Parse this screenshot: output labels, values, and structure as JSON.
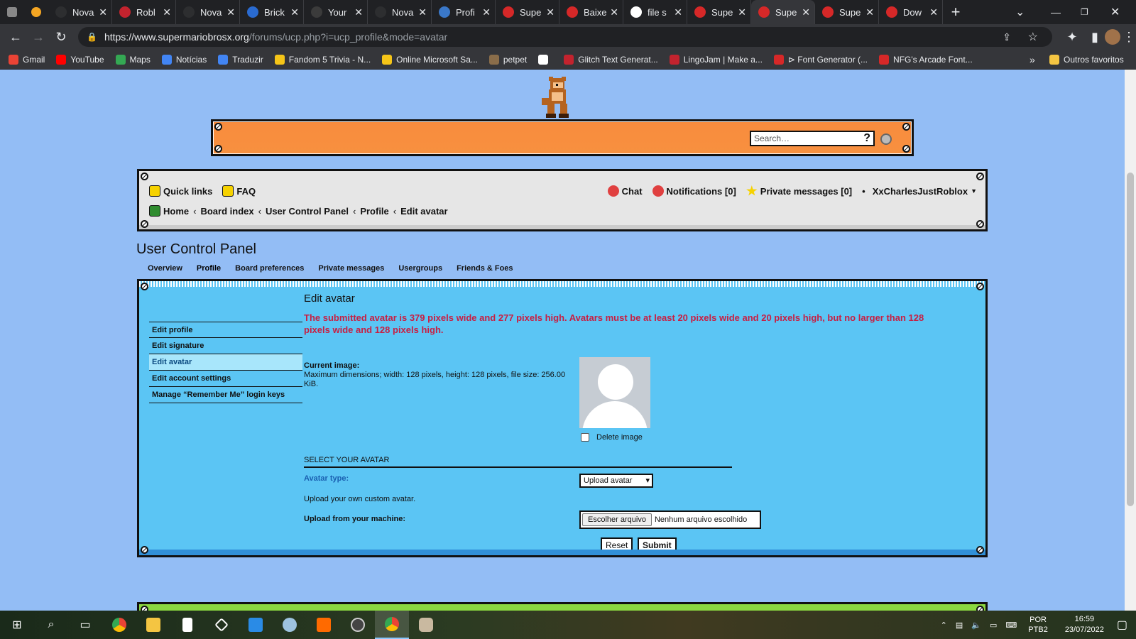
{
  "browser": {
    "tabs": [
      {
        "title": "Nova",
        "color": "#2d2e30",
        "active": false
      },
      {
        "title": "Robl",
        "color": "#c3232e",
        "active": false
      },
      {
        "title": "Nova",
        "color": "#2d2e30",
        "active": false
      },
      {
        "title": "Brick",
        "color": "#2a6bd1",
        "active": false
      },
      {
        "title": "Your",
        "color": "#3b3b3b",
        "active": false
      },
      {
        "title": "Nova",
        "color": "#2d2e30",
        "active": false
      },
      {
        "title": "Profi",
        "color": "#3a78c9",
        "active": false
      },
      {
        "title": "Supe",
        "color": "#d62828",
        "active": false
      },
      {
        "title": "Baixe",
        "color": "#d62828",
        "active": false
      },
      {
        "title": "file s",
        "color": "#ffffff",
        "active": false
      },
      {
        "title": "Supe",
        "color": "#d62828",
        "active": false
      },
      {
        "title": "Supe",
        "color": "#d62828",
        "active": true
      },
      {
        "title": "Supe",
        "color": "#d62828",
        "active": false
      },
      {
        "title": "Dow",
        "color": "#d62828",
        "active": false
      }
    ],
    "url_host": "https://www.supermariobrosx.org",
    "url_path": "/forums/ucp.php?i=ucp_profile&mode=avatar",
    "bookmarks": [
      {
        "label": "Gmail",
        "color": "#ea4335"
      },
      {
        "label": "YouTube",
        "color": "#ff0000"
      },
      {
        "label": "Maps",
        "color": "#34a853"
      },
      {
        "label": "Notícias",
        "color": "#4285f4"
      },
      {
        "label": "Traduzir",
        "color": "#4285f4"
      },
      {
        "label": "Fandom 5 Trivia - N...",
        "color": "#f5c518"
      },
      {
        "label": "Online Microsoft Sa...",
        "color": "#f5c518"
      },
      {
        "label": "petpet",
        "color": "#8a6d4a"
      },
      {
        "label": "",
        "color": "#ffffff"
      },
      {
        "label": "Glitch Text Generat...",
        "color": "#c3232e"
      },
      {
        "label": "LingoJam | Make a...",
        "color": "#c3232e"
      },
      {
        "label": "⊳ Font Generator (...",
        "color": "#d62828"
      },
      {
        "label": "NFG's Arcade Font...",
        "color": "#d62828"
      }
    ],
    "other_bookmarks": "Outros favoritos"
  },
  "header": {
    "search_placeholder": "Search…",
    "search_help": "?"
  },
  "nav": {
    "quick_links": "Quick links",
    "faq": "FAQ",
    "chat": "Chat",
    "notifications": "Notifications [0]",
    "private_messages": "Private messages [0]",
    "bullet": "•",
    "username": "XxCharlesJustRoblox",
    "breadcrumbs": [
      "Home",
      "Board index",
      "User Control Panel",
      "Profile",
      "Edit avatar"
    ]
  },
  "ucp": {
    "title": "User Control Panel",
    "tabs": [
      "Overview",
      "Profile",
      "Board preferences",
      "Private messages",
      "Usergroups",
      "Friends & Foes"
    ],
    "sidebar": [
      "Edit profile",
      "Edit signature",
      "Edit avatar",
      "Edit account settings",
      "Manage “Remember Me” login keys"
    ],
    "edit_title": "Edit avatar",
    "error": "The submitted avatar is 379 pixels wide and 277 pixels high. Avatars must be at least 20 pixels wide and 20 pixels high, but no larger than 128 pixels wide and 128 pixels high.",
    "current_image_label": "Current image:",
    "current_image_desc": "Maximum dimensions; width: 128 pixels, height: 128 pixels, file size: 256.00 KiB.",
    "delete_image": "Delete image",
    "select_heading": "SELECT YOUR AVATAR",
    "avatar_type_label": "Avatar type:",
    "avatar_type_value": "Upload avatar",
    "upload_own": "Upload your own custom avatar.",
    "upload_label": "Upload from your machine:",
    "file_button": "Escolher arquivo",
    "file_status": "Nenhum arquivo escolhido",
    "reset": "Reset",
    "submit": "Submit"
  },
  "taskbar": {
    "lang_top": "POR",
    "lang_bottom": "PTB2",
    "time": "16:59",
    "date": "23/07/2022"
  }
}
